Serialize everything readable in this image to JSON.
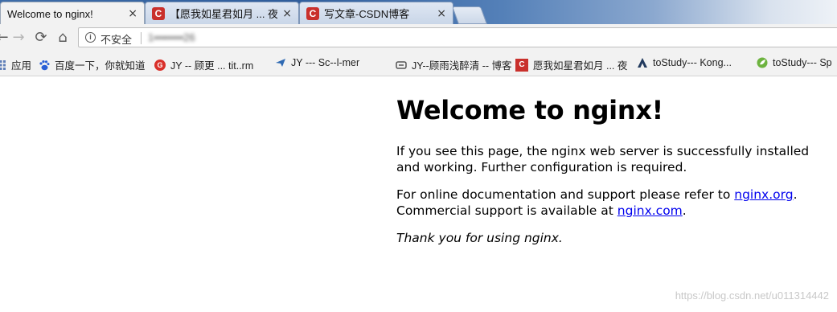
{
  "tabs": [
    {
      "title": "Welcome to nginx!",
      "active": true,
      "favicon": ""
    },
    {
      "title": "【愿我如星君如月 ... 夜夜",
      "active": false,
      "favicon": "csdn-icon"
    },
    {
      "title": "写文章-CSDN博客",
      "active": false,
      "favicon": "csdn-icon"
    }
  ],
  "tab_close": "×",
  "toolbar": {
    "back": "←",
    "forward": "→",
    "reload": "⟳",
    "home": "⌂",
    "security_label": "不安全",
    "info_glyph": "i",
    "url": "1▪▪▪▪▪▪▪▪26"
  },
  "bookmarks": [
    {
      "label": "应用",
      "icon": "apps-icon"
    },
    {
      "label": "百度一下，你就知道",
      "icon": "baidu-paw-icon"
    },
    {
      "label": "JY -- 顾更 ... tit..rm",
      "icon": "gitee-icon"
    },
    {
      "label": "JY --- Sc--l-mer",
      "icon": "paper-plane-icon"
    },
    {
      "label": "JY--顾雨浅醉清 -- 博客",
      "icon": "link-icon"
    },
    {
      "label": "愿我如星君如月 ... 夜",
      "icon": "csdn-icon"
    },
    {
      "label": "toStudy--- Kong...",
      "icon": "arch-icon"
    },
    {
      "label": "toStudy--- Sp",
      "icon": "spring-icon"
    }
  ],
  "page": {
    "heading": "Welcome to nginx!",
    "p1": "If you see this page, the nginx web server is successfully installed and working. Further configuration is required.",
    "p2_prefix": "For online documentation and support please refer to ",
    "link1": "nginx.org",
    "p2_mid": ".",
    "p2_line2_prefix": "Commercial support is available at ",
    "link2": "nginx.com",
    "p2_end": ".",
    "p3": "Thank you for using nginx."
  },
  "watermark": "https://blog.csdn.net/u011314442"
}
